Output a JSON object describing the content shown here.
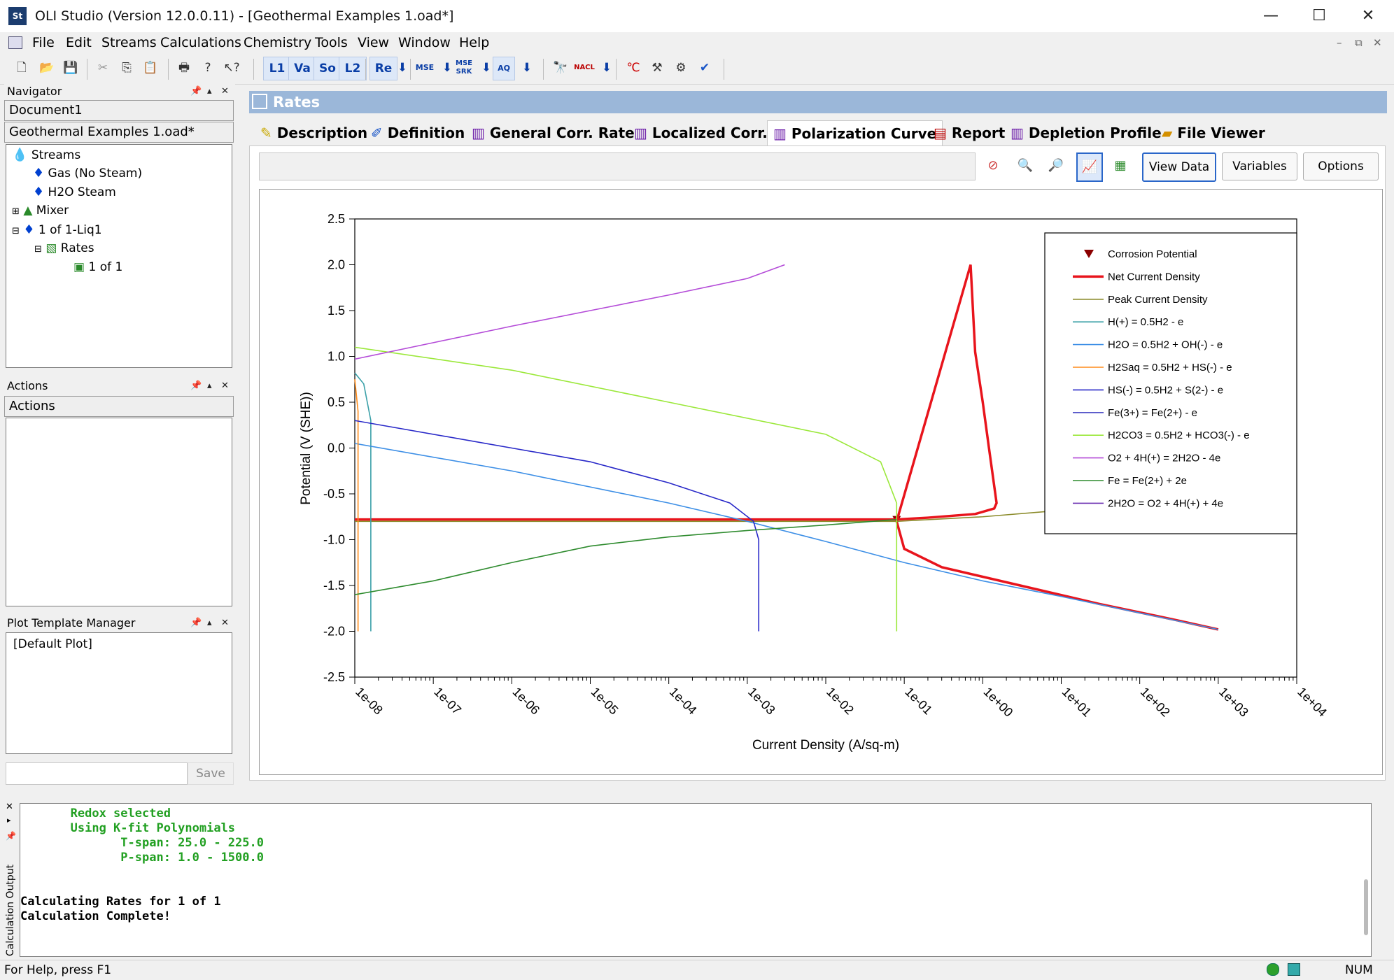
{
  "window": {
    "title": "OLI Studio (Version 12.0.0.11) - [Geothermal Examples 1.oad*]",
    "icon": "St",
    "controls": [
      "minimize-icon",
      "maximize-icon",
      "close-icon"
    ]
  },
  "menu": {
    "items": [
      "File",
      "Edit",
      "Streams",
      "Calculations",
      "Chemistry",
      "Tools",
      "View",
      "Window",
      "Help"
    ]
  },
  "toolbar": {
    "buttons": [
      "L1",
      "Va",
      "So",
      "L2",
      "Re",
      "MSE",
      "SRK",
      "AQ",
      "NACL"
    ]
  },
  "navigator": {
    "title": "Navigator",
    "documents": [
      "Document1",
      "Geothermal Examples 1.oad*"
    ],
    "tree": [
      "Streams",
      "Gas (No Steam)",
      "H2O Steam",
      "Mixer",
      "1 of 1-Liq1",
      "Rates",
      "1 of 1"
    ]
  },
  "actions_panel": {
    "title": "Actions",
    "header": "Actions"
  },
  "plot_template": {
    "title": "Plot Template Manager",
    "items": [
      "[Default Plot]"
    ],
    "save_label": "Save",
    "name_value": ""
  },
  "main": {
    "header": "Rates",
    "tabs": [
      "Description",
      "Definition",
      "General Corr. Rate",
      "Localized Corr.",
      "Polarization Curve",
      "Report",
      "Depletion Profile",
      "File Viewer"
    ],
    "active_tab": "Polarization Curve",
    "buttons": {
      "view_data": "View Data",
      "variables": "Variables",
      "options": "Options"
    }
  },
  "chart_data": {
    "type": "line",
    "xlabel": "Current Density (A/sq-m)",
    "ylabel": "Potential (V (SHE))",
    "xscale": "log",
    "xlim": [
      1e-08,
      10000.0
    ],
    "ylim": [
      -2.5,
      2.5
    ],
    "xticks": [
      "1e-08",
      "1e-07",
      "1e-06",
      "1e-05",
      "1e-04",
      "1e-03",
      "1e-02",
      "1e-01",
      "1e+00",
      "1e+01",
      "1e+02",
      "1e+03",
      "1e+04"
    ],
    "yticks": [
      "2.5",
      "2.0",
      "1.5",
      "1.0",
      "0.5",
      "0.0",
      "-0.5",
      "-1.0",
      "-1.5",
      "-2.0",
      "-2.5"
    ],
    "legend_position": "top-right",
    "series": [
      {
        "name": "Corrosion Potential",
        "color": "#8b0000",
        "marker": "triangle-down",
        "x": [
          0.08
        ],
        "y": [
          -0.78
        ]
      },
      {
        "name": "Net Current Density",
        "color": "#e8141c",
        "x": [
          1e-08,
          1e-06,
          0.0001,
          0.01,
          0.05,
          0.08,
          0.2,
          0.8,
          1.4,
          1.5,
          1.2,
          1.0,
          0.8,
          0.7,
          0.08,
          0.1,
          0.3,
          3,
          30,
          300,
          1000
        ],
        "y": [
          -0.78,
          -0.78,
          -0.78,
          -0.78,
          -0.78,
          -0.78,
          -0.76,
          -0.72,
          -0.66,
          -0.6,
          0.0,
          0.5,
          1.05,
          2.0,
          -0.8,
          -1.1,
          -1.3,
          -1.5,
          -1.7,
          -1.88,
          -1.98
        ]
      },
      {
        "name": "Peak Current Density",
        "color": "#8b8b2a",
        "x": [
          1e-08,
          0.08,
          1,
          10,
          100,
          1000,
          10000
        ],
        "y": [
          -0.8,
          -0.8,
          -0.75,
          -0.68,
          -0.62,
          -0.56,
          -0.5
        ]
      },
      {
        "name": "H(+) = 0.5H2 - e",
        "color": "#3aa0a8",
        "x": [
          1e-08,
          1.3e-08,
          1.6e-08,
          1.6e-08
        ],
        "y": [
          0.82,
          0.7,
          0.3,
          -2.0
        ]
      },
      {
        "name": "H2O = 0.5H2 + OH(-) - e",
        "color": "#3d8fe6",
        "x": [
          1e-08,
          1e-06,
          0.0001,
          0.001,
          0.01,
          0.1,
          1,
          10,
          100,
          1000
        ],
        "y": [
          0.05,
          -0.25,
          -0.6,
          -0.8,
          -1.02,
          -1.25,
          -1.45,
          -1.62,
          -1.8,
          -1.98
        ]
      },
      {
        "name": "H2Saq = 0.5H2 + HS(-) - e",
        "color": "#ff8c1a",
        "x": [
          1e-08,
          1.1e-08,
          1.1e-08
        ],
        "y": [
          0.75,
          0.4,
          -2.0
        ]
      },
      {
        "name": "HS(-) = 0.5H2 + S(2-) - e",
        "color": "#2828c8",
        "x": [
          1e-08,
          1e-06,
          1e-05,
          0.0001,
          0.0006,
          0.0012,
          0.0014,
          0.0014
        ],
        "y": [
          0.3,
          0.0,
          -0.15,
          -0.38,
          -0.6,
          -0.8,
          -1.0,
          -2.0
        ]
      },
      {
        "name": "Fe(3+) = Fe(2+) - e",
        "color": "#5050c8",
        "x": [],
        "y": []
      },
      {
        "name": "H2CO3 = 0.5H2 + HCO3(-) - e",
        "color": "#9be83a",
        "x": [
          1e-08,
          1e-06,
          0.0001,
          0.01,
          0.05,
          0.08,
          0.08
        ],
        "y": [
          1.1,
          0.85,
          0.5,
          0.15,
          -0.15,
          -0.6,
          -2.0
        ]
      },
      {
        "name": "O2 + 4H(+) = 2H2O - 4e",
        "color": "#b44bd8",
        "x": [
          1e-08,
          1e-07,
          1e-06,
          1e-05,
          0.0001,
          0.001,
          0.003
        ],
        "y": [
          0.97,
          1.15,
          1.33,
          1.5,
          1.67,
          1.85,
          2.0
        ]
      },
      {
        "name": "Fe = Fe(2+) + 2e",
        "color": "#2e8b2e",
        "x": [
          1e-08,
          1e-07,
          1e-06,
          1e-05,
          0.0001,
          0.001,
          0.01,
          0.08
        ],
        "y": [
          -1.6,
          -1.45,
          -1.25,
          -1.07,
          -0.97,
          -0.9,
          -0.84,
          -0.78
        ]
      },
      {
        "name": "2H2O = O2 + 4H(+) + 4e",
        "color": "#6a2fb0",
        "x": [],
        "y": []
      }
    ]
  },
  "output": {
    "lines": [
      {
        "text": "       Redox selected",
        "color": "#22a022"
      },
      {
        "text": "       Using K-fit Polynomials",
        "color": "#22a022"
      },
      {
        "text": "              T-span: 25.0 - 225.0",
        "color": "#22a022"
      },
      {
        "text": "              P-span: 1.0 - 1500.0",
        "color": "#22a022"
      },
      {
        "text": "",
        "color": "#000000"
      },
      {
        "text": "",
        "color": "#000000"
      },
      {
        "text": "Calculating Rates for 1 of 1",
        "color": "#000000"
      },
      {
        "text": "Calculation Complete!",
        "color": "#000000"
      }
    ],
    "side_label": "Calculation Output"
  },
  "status": {
    "help": "For Help, press F1",
    "num": "NUM"
  }
}
